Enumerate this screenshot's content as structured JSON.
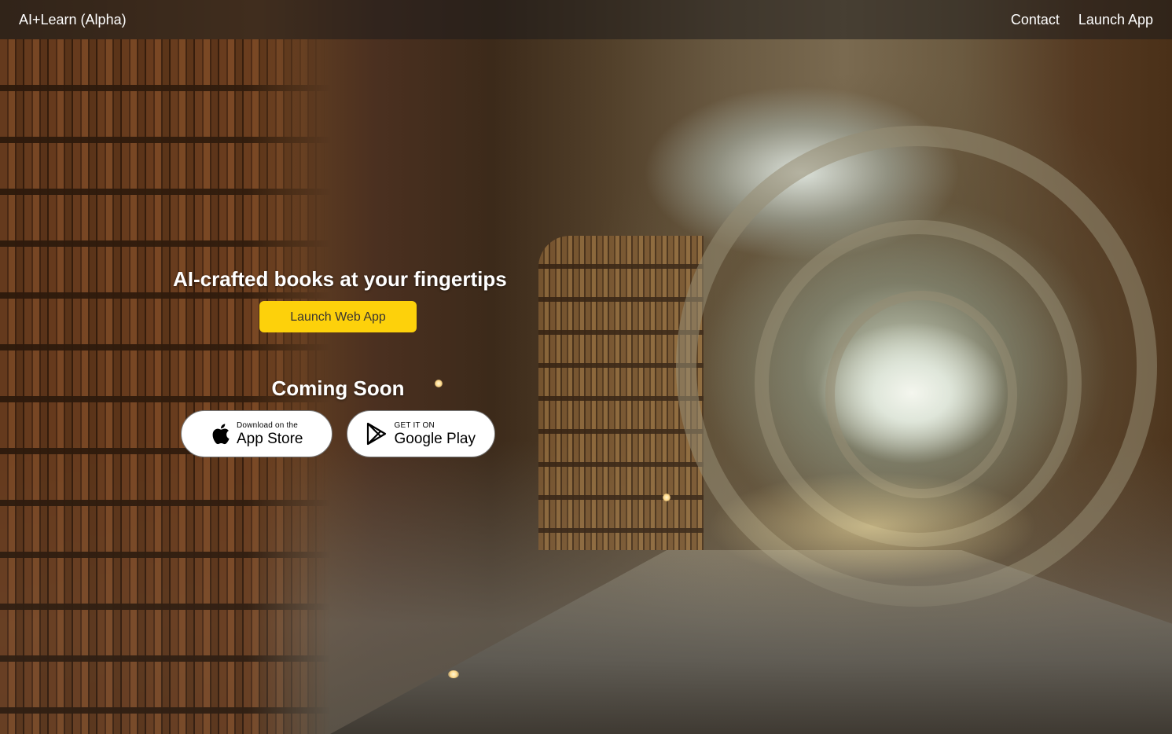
{
  "nav": {
    "brand": "AI+Learn (Alpha)",
    "links": [
      {
        "label": "Contact"
      },
      {
        "label": "Launch App"
      }
    ]
  },
  "hero": {
    "headline": "AI-crafted books at your fingertips",
    "cta_label": "Launch Web App",
    "cta_color": "#fdd10b",
    "coming_soon": "Coming Soon"
  },
  "stores": {
    "app_store": {
      "small": "Download on the",
      "big": "App Store",
      "icon": "apple-icon"
    },
    "google_play": {
      "small": "GET IT ON",
      "big": "Google Play",
      "icon": "google-play-icon"
    }
  }
}
